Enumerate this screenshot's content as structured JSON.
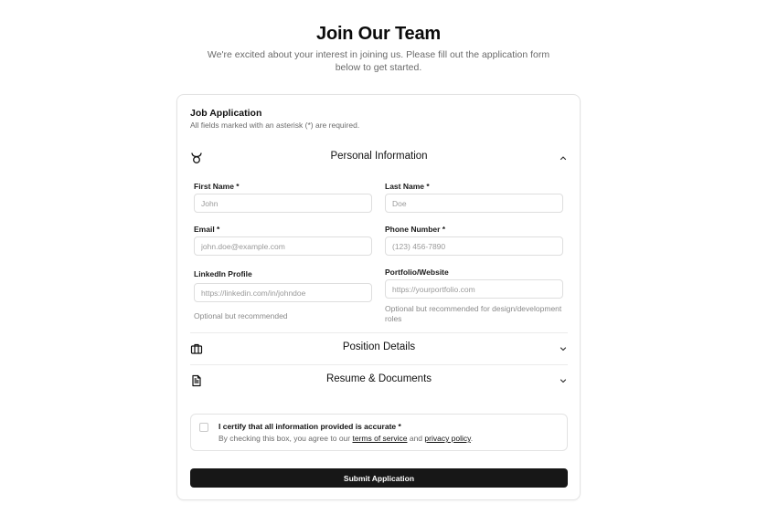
{
  "header": {
    "title": "Join Our Team",
    "subtitle": "We're excited about your interest in joining us. Please fill out the application form below to get started."
  },
  "form": {
    "title": "Job Application",
    "description": "All fields marked with an asterisk (*) are required.",
    "sections": {
      "personal": {
        "label": "Personal Information",
        "icon": "taurus-icon",
        "expanded": true
      },
      "position": {
        "label": "Position Details",
        "icon": "briefcase-icon",
        "expanded": false
      },
      "resume": {
        "label": "Resume & Documents",
        "icon": "file-text-icon",
        "expanded": false
      }
    },
    "fields": {
      "first_name": {
        "label": "First Name *",
        "placeholder": "John",
        "value": ""
      },
      "last_name": {
        "label": "Last Name *",
        "placeholder": "Doe",
        "value": ""
      },
      "email": {
        "label": "Email *",
        "placeholder": "john.doe@example.com",
        "value": ""
      },
      "phone": {
        "label": "Phone Number *",
        "placeholder": "(123) 456-7890",
        "value": ""
      },
      "linkedin": {
        "label": "LinkedIn Profile",
        "placeholder": "https://linkedin.com/in/johndoe",
        "value": "",
        "hint": "Optional but recommended"
      },
      "portfolio": {
        "label": "Portfolio/Website",
        "placeholder": "https://yourportfolio.com",
        "value": "",
        "hint": "Optional but recommended for design/development roles"
      }
    },
    "certify": {
      "label": "I certify that all information provided is accurate *",
      "desc_prefix": "By checking this box, you agree to our ",
      "terms_link": "terms of service",
      "desc_middle": " and ",
      "privacy_link": "privacy policy",
      "desc_suffix": ".",
      "checked": false
    },
    "submit_label": "Submit Application"
  },
  "colors": {
    "primary_button": "#171717",
    "muted_text": "#6b6b6b",
    "border": "#e3e3e3"
  }
}
